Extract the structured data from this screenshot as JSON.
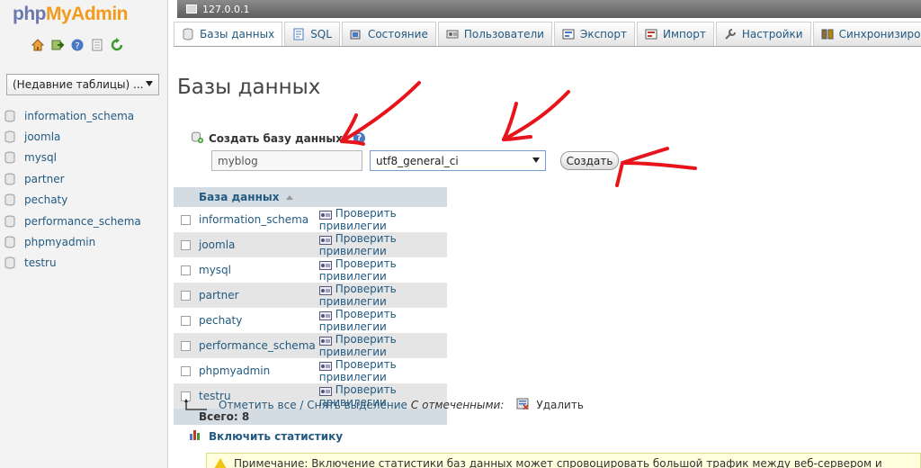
{
  "logo": {
    "part1": "php",
    "part2": "MyAdmin"
  },
  "sidebar": {
    "recent_tables": "(Недавние таблицы) ...",
    "databases": [
      "information_schema",
      "joomla",
      "mysql",
      "partner",
      "pechaty",
      "performance_schema",
      "phpmyadmin",
      "testru"
    ]
  },
  "serverbar": {
    "host": "127.0.0.1"
  },
  "tabs": [
    {
      "label": "Базы данных",
      "icon": "database-icon",
      "active": true
    },
    {
      "label": "SQL",
      "icon": "sql-icon"
    },
    {
      "label": "Состояние",
      "icon": "status-icon"
    },
    {
      "label": "Пользователи",
      "icon": "users-icon"
    },
    {
      "label": "Экспорт",
      "icon": "export-icon"
    },
    {
      "label": "Импорт",
      "icon": "import-icon"
    },
    {
      "label": "Настройки",
      "icon": "wrench-icon"
    },
    {
      "label": "Синхронизиро",
      "icon": "sync-icon"
    }
  ],
  "main": {
    "title": "Базы данных",
    "create_label": "Создать базу данных",
    "db_name_value": "myblog",
    "collation_value": "utf8_general_ci",
    "create_button": "Создать",
    "table": {
      "header": "База данных",
      "priv_label": "Проверить привилегии",
      "rows": [
        "information_schema",
        "joomla",
        "mysql",
        "partner",
        "pechaty",
        "performance_schema",
        "phpmyadmin",
        "testru"
      ],
      "total": "Всего: 8"
    },
    "check_all": "Отметить все",
    "separator": " / ",
    "uncheck_all": "Снять выделение",
    "with_selected": "С отмеченными:",
    "delete": "Удалить",
    "enable_stats": "Включить статистику",
    "notice": "Примечание: Включение статистики баз данных может спровоцировать большой трафик между веб-сервером и сервером MySQL."
  },
  "colors": {
    "link": "#235a81",
    "accent_orange": "#f29a1d",
    "logo_blue": "#6c78af",
    "annotation_red": "#e8141c"
  }
}
